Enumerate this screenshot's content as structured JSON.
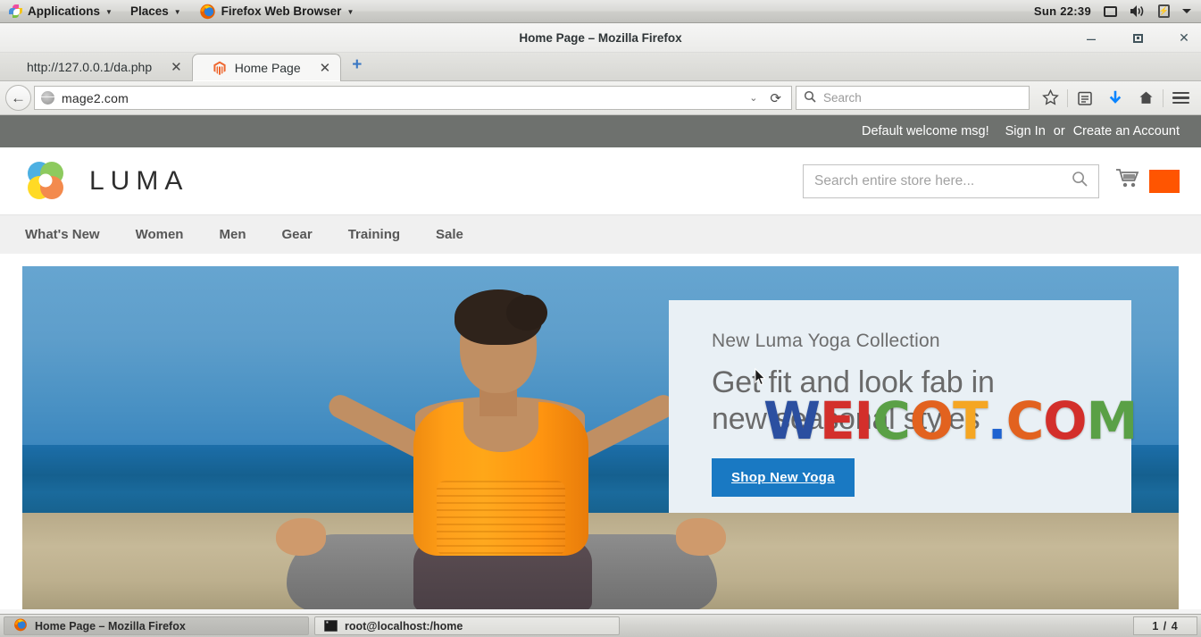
{
  "desktop": {
    "panel": {
      "applications": "Applications",
      "places": "Places",
      "firefox_menu": "Firefox Web Browser",
      "clock": "Sun 22:39",
      "icons": [
        "app-pinwheel-icon",
        "firefox-icon",
        "display-icon",
        "volume-icon",
        "battery-icon",
        "caret-down-icon"
      ]
    },
    "taskbar": {
      "tasks": [
        {
          "label": "Home Page – Mozilla Firefox",
          "icon": "firefox-icon",
          "active": true
        },
        {
          "label": "root@localhost:/home",
          "icon": "terminal-icon",
          "active": false
        }
      ],
      "workspace": "1 / 4"
    }
  },
  "browser": {
    "window_title": "Home Page – Mozilla Firefox",
    "window_buttons": {
      "minimize": "–",
      "maximize": "□",
      "close": "✕"
    },
    "tabs": [
      {
        "title": "http://127.0.0.1/da.php",
        "favicon": "none",
        "close": "✕",
        "active": false
      },
      {
        "title": "Home Page",
        "favicon": "magento-icon",
        "close": "✕",
        "active": true
      }
    ],
    "new_tab_label": "+",
    "toolbar": {
      "back_icon": "back-arrow-icon",
      "url": "mage2.com",
      "url_dropdown_icon": "chevron-down-icon",
      "reload_icon": "reload-icon",
      "search_placeholder": "Search",
      "search_icon": "search-icon",
      "icons": [
        "bookmark-star-icon",
        "library-icon",
        "downloads-icon",
        "home-icon",
        "menu-icon"
      ]
    }
  },
  "store": {
    "topbar": {
      "welcome": "Default welcome msg!",
      "sign_in": "Sign In",
      "or": "or",
      "create_account": "Create an Account"
    },
    "header": {
      "logo_alt": "luma-logo",
      "wordmark": "LUMA",
      "search_placeholder": "Search entire store here...",
      "search_icon": "search-icon",
      "cart_icon": "cart-icon",
      "cart_swatch_color": "#ff5501"
    },
    "nav": [
      {
        "label": "What's New"
      },
      {
        "label": "Women"
      },
      {
        "label": "Men"
      },
      {
        "label": "Gear"
      },
      {
        "label": "Training"
      },
      {
        "label": "Sale"
      }
    ],
    "hero": {
      "eyebrow": "New Luma Yoga Collection",
      "title_line1": "Get fit and look fab in",
      "title_line2": "new seasonal styles",
      "button": "Shop New Yoga",
      "button_color": "#1979c3",
      "panel_bg": "#e9f0f5"
    },
    "watermark": {
      "letters": [
        {
          "ch": "W",
          "color": "#2b4fa0"
        },
        {
          "ch": "E",
          "color": "#d32f2b"
        },
        {
          "ch": "I",
          "color": "#d32f2b"
        },
        {
          "ch": "C",
          "color": "#5aa046"
        },
        {
          "ch": "O",
          "color": "#e2621f"
        },
        {
          "ch": "T",
          "color": "#f5a623"
        },
        {
          "ch": ".",
          "color": "#1e62d0"
        },
        {
          "ch": "C",
          "color": "#e2621f"
        },
        {
          "ch": "O",
          "color": "#d32f2b"
        },
        {
          "ch": "M",
          "color": "#5aa046"
        }
      ]
    }
  }
}
